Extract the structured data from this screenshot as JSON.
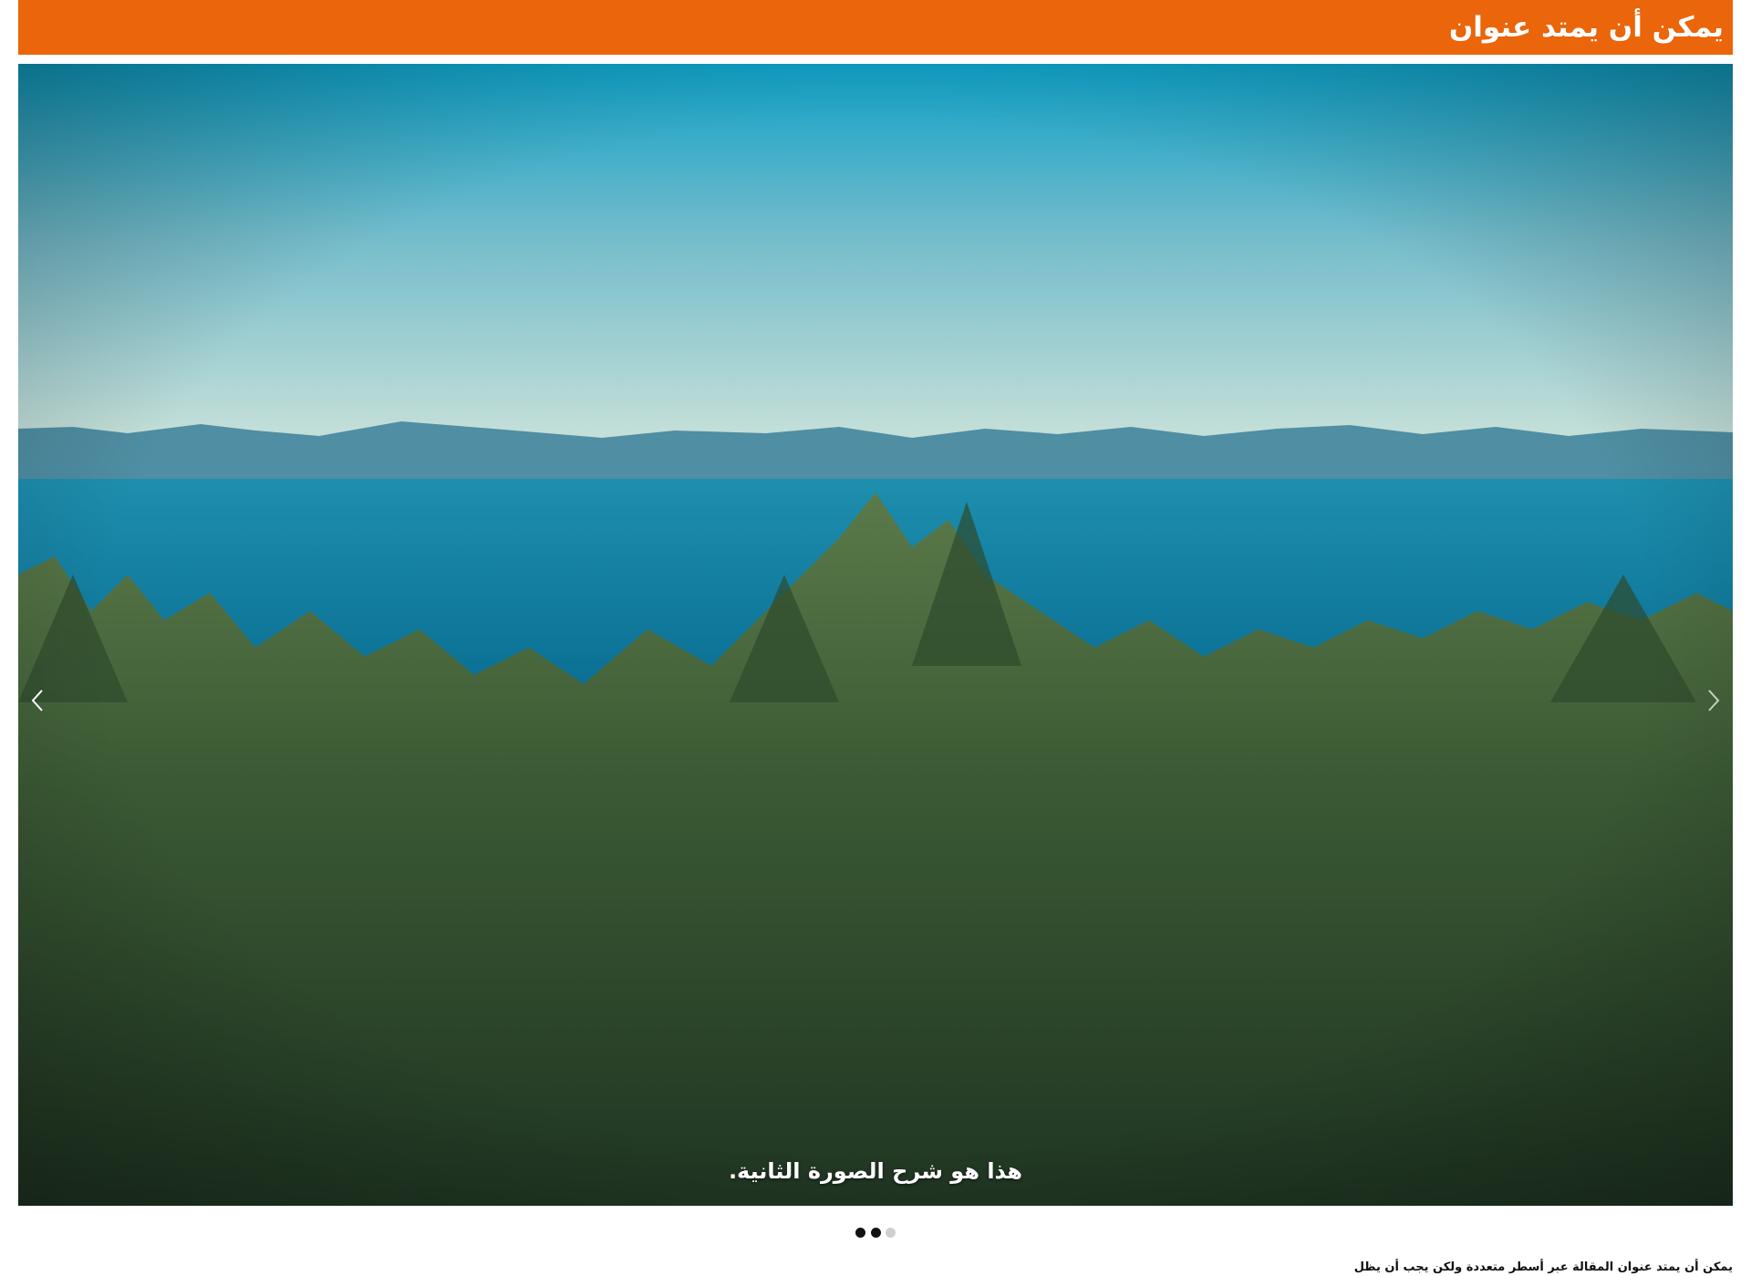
{
  "header": {
    "title": "يمكن أن يمتد عنوان",
    "background_color": "#eb650a"
  },
  "slider": {
    "caption": "هذا هو شرح الصورة الثانية.",
    "prev_icon": "chevron-left-icon",
    "next_icon": "chevron-right-icon",
    "indicators": [
      {
        "state": "active"
      },
      {
        "state": "active"
      },
      {
        "state": "inactive"
      }
    ]
  },
  "article": {
    "title": "يمكن أن يمتد عنوان المقالة عبر أسطر متعددة ولكن يجب أن يظل"
  }
}
